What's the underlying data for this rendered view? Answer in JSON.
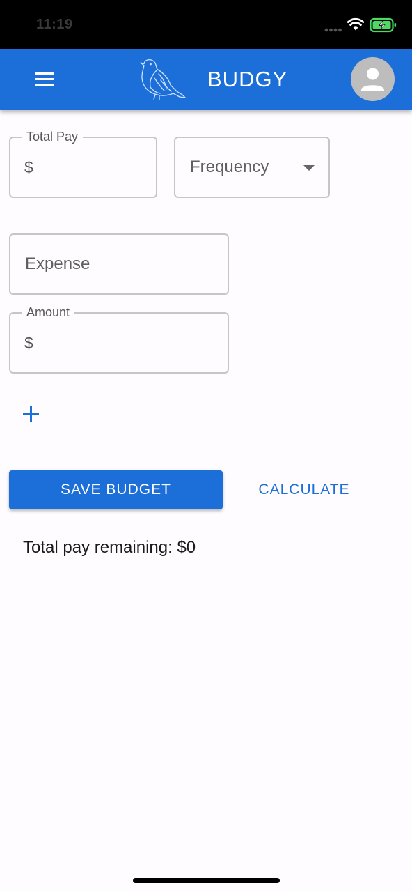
{
  "status_bar": {
    "time": "11:19",
    "battery_color": "#4cd964"
  },
  "app_bar": {
    "title": "BUDGY",
    "background": "#1c6fd8",
    "menu_icon": "hamburger-menu-icon",
    "logo_icon": "bird-logo-icon",
    "avatar_icon": "person-icon"
  },
  "form": {
    "total_pay": {
      "label": "Total Pay",
      "prefix": "$",
      "value": ""
    },
    "frequency": {
      "placeholder": "Frequency",
      "value": ""
    },
    "expense": {
      "placeholder": "Expense",
      "value": ""
    },
    "amount": {
      "label": "Amount",
      "prefix": "$",
      "value": ""
    },
    "add_icon": "plus-icon"
  },
  "actions": {
    "save_label": "SAVE BUDGET",
    "calculate_label": "CALCULATE"
  },
  "summary": {
    "remaining_text": "Total pay remaining: $0"
  }
}
